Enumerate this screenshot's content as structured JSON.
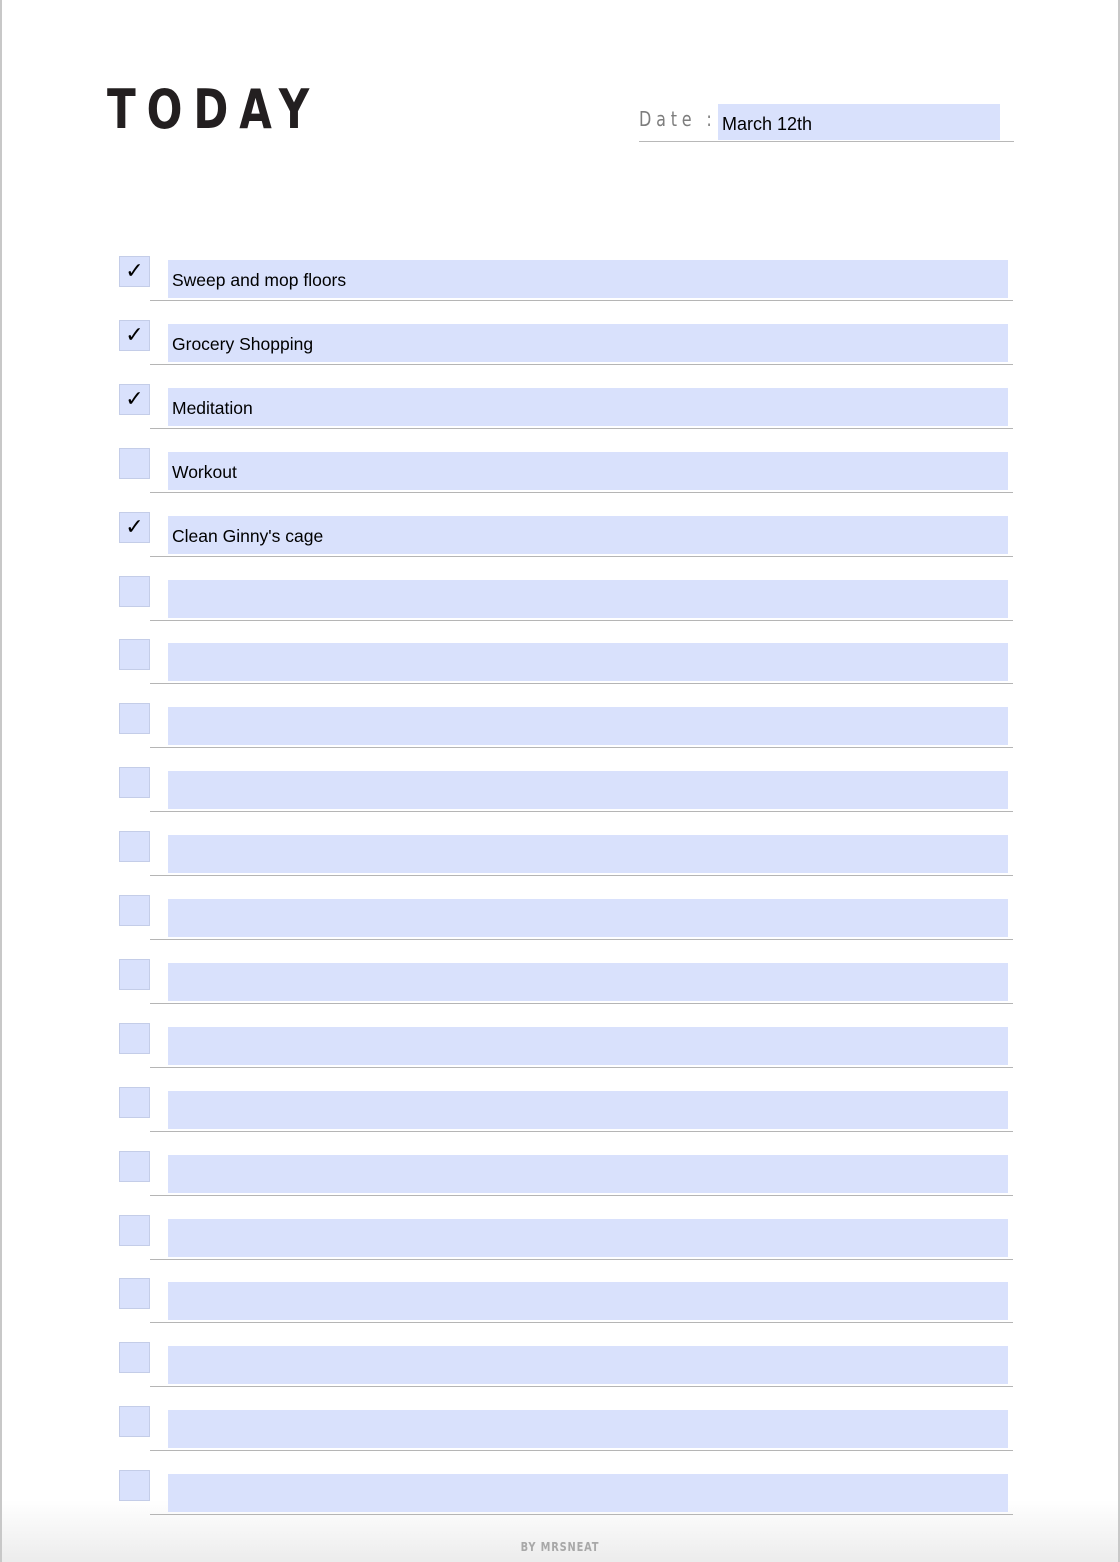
{
  "header": {
    "title": "TODAY",
    "date_label": "Date :",
    "date_value": "March 12th"
  },
  "colors": {
    "field_fill": "#d9e1fc",
    "rule": "#b5b5b5",
    "title": "#231f20"
  },
  "tasks": [
    {
      "checked": true,
      "check_glyph": "✓",
      "text": "Sweep and mop floors"
    },
    {
      "checked": true,
      "check_glyph": "✓",
      "text": "Grocery Shopping"
    },
    {
      "checked": true,
      "check_glyph": "✓",
      "text": "Meditation"
    },
    {
      "checked": false,
      "check_glyph": "",
      "text": "Workout"
    },
    {
      "checked": true,
      "check_glyph": "✓",
      "text": "Clean Ginny's cage"
    },
    {
      "checked": false,
      "check_glyph": "",
      "text": ""
    },
    {
      "checked": false,
      "check_glyph": "",
      "text": ""
    },
    {
      "checked": false,
      "check_glyph": "",
      "text": ""
    },
    {
      "checked": false,
      "check_glyph": "",
      "text": ""
    },
    {
      "checked": false,
      "check_glyph": "",
      "text": ""
    },
    {
      "checked": false,
      "check_glyph": "",
      "text": ""
    },
    {
      "checked": false,
      "check_glyph": "",
      "text": ""
    },
    {
      "checked": false,
      "check_glyph": "",
      "text": ""
    },
    {
      "checked": false,
      "check_glyph": "",
      "text": ""
    },
    {
      "checked": false,
      "check_glyph": "",
      "text": ""
    },
    {
      "checked": false,
      "check_glyph": "",
      "text": ""
    },
    {
      "checked": false,
      "check_glyph": "",
      "text": ""
    },
    {
      "checked": false,
      "check_glyph": "",
      "text": ""
    },
    {
      "checked": false,
      "check_glyph": "",
      "text": ""
    },
    {
      "checked": false,
      "check_glyph": "",
      "text": ""
    }
  ],
  "footer": {
    "credit": "BY MRSNEAT"
  }
}
